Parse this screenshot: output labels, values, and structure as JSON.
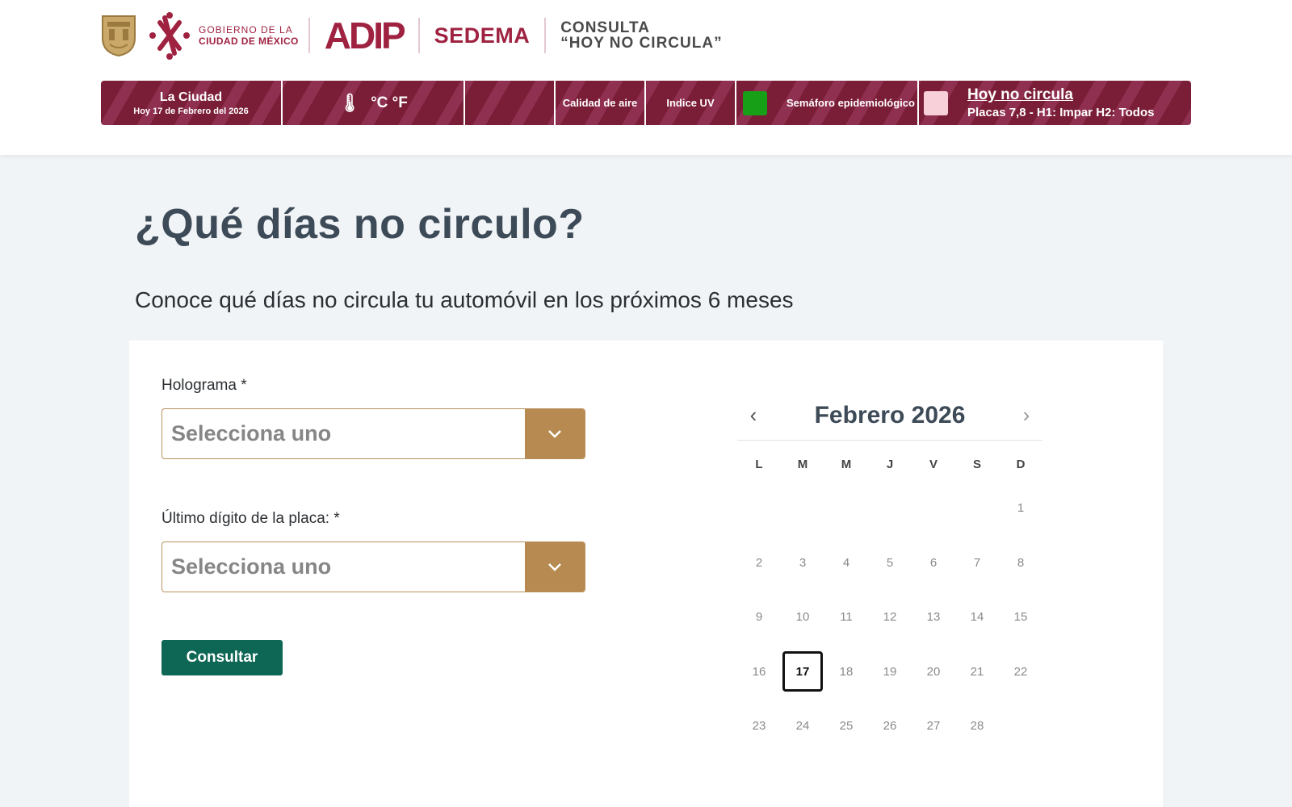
{
  "header": {
    "gob_line1": "GOBIERNO DE LA",
    "gob_line2": "CIUDAD DE MÉXICO",
    "adip_a": "A",
    "adip_dip": "DIP",
    "sedema": "SEDEMA",
    "consulta_line1": "CONSULTA",
    "consulta_line2": "“HOY NO CIRCULA”"
  },
  "info_bar": {
    "city": "La Ciudad",
    "date": "Hoy 17 de Febrero del 2026",
    "temp": "°C °F",
    "air_quality": "Calidad de aire",
    "uv_index": "Indice UV",
    "semaforo": "Semáforo epidemiológico",
    "semaforo_color": "#17a017",
    "hnc_title": "Hoy no circula",
    "hnc_sub": "Placas 7,8 - H1: Impar H2: Todos",
    "hnc_color": "#f7d0d9"
  },
  "main": {
    "title": "¿Qué días no circulo?",
    "subtitle": "Conoce qué días no circula tu automóvil en los próximos 6 meses"
  },
  "form": {
    "hologram_label": "Holograma *",
    "hologram_value": "Selecciona uno",
    "plate_label": "Último dígito de la placa: *",
    "plate_value": "Selecciona uno",
    "submit_label": "Consultar"
  },
  "calendar": {
    "title": "Febrero 2026",
    "prev": "‹",
    "next": "›",
    "weekdays": [
      "L",
      "M",
      "M",
      "J",
      "V",
      "S",
      "D"
    ],
    "leading_blanks": 6,
    "days": [
      "1",
      "2",
      "3",
      "4",
      "5",
      "6",
      "7",
      "8",
      "9",
      "10",
      "11",
      "12",
      "13",
      "14",
      "15",
      "16",
      "17",
      "18",
      "19",
      "20",
      "21",
      "22",
      "23",
      "24",
      "25",
      "26",
      "27",
      "28"
    ],
    "today": "17"
  },
  "colors": {
    "brand_wine": "#9f2241",
    "accent_gold": "#b68a50",
    "button_green": "#0e6654"
  }
}
